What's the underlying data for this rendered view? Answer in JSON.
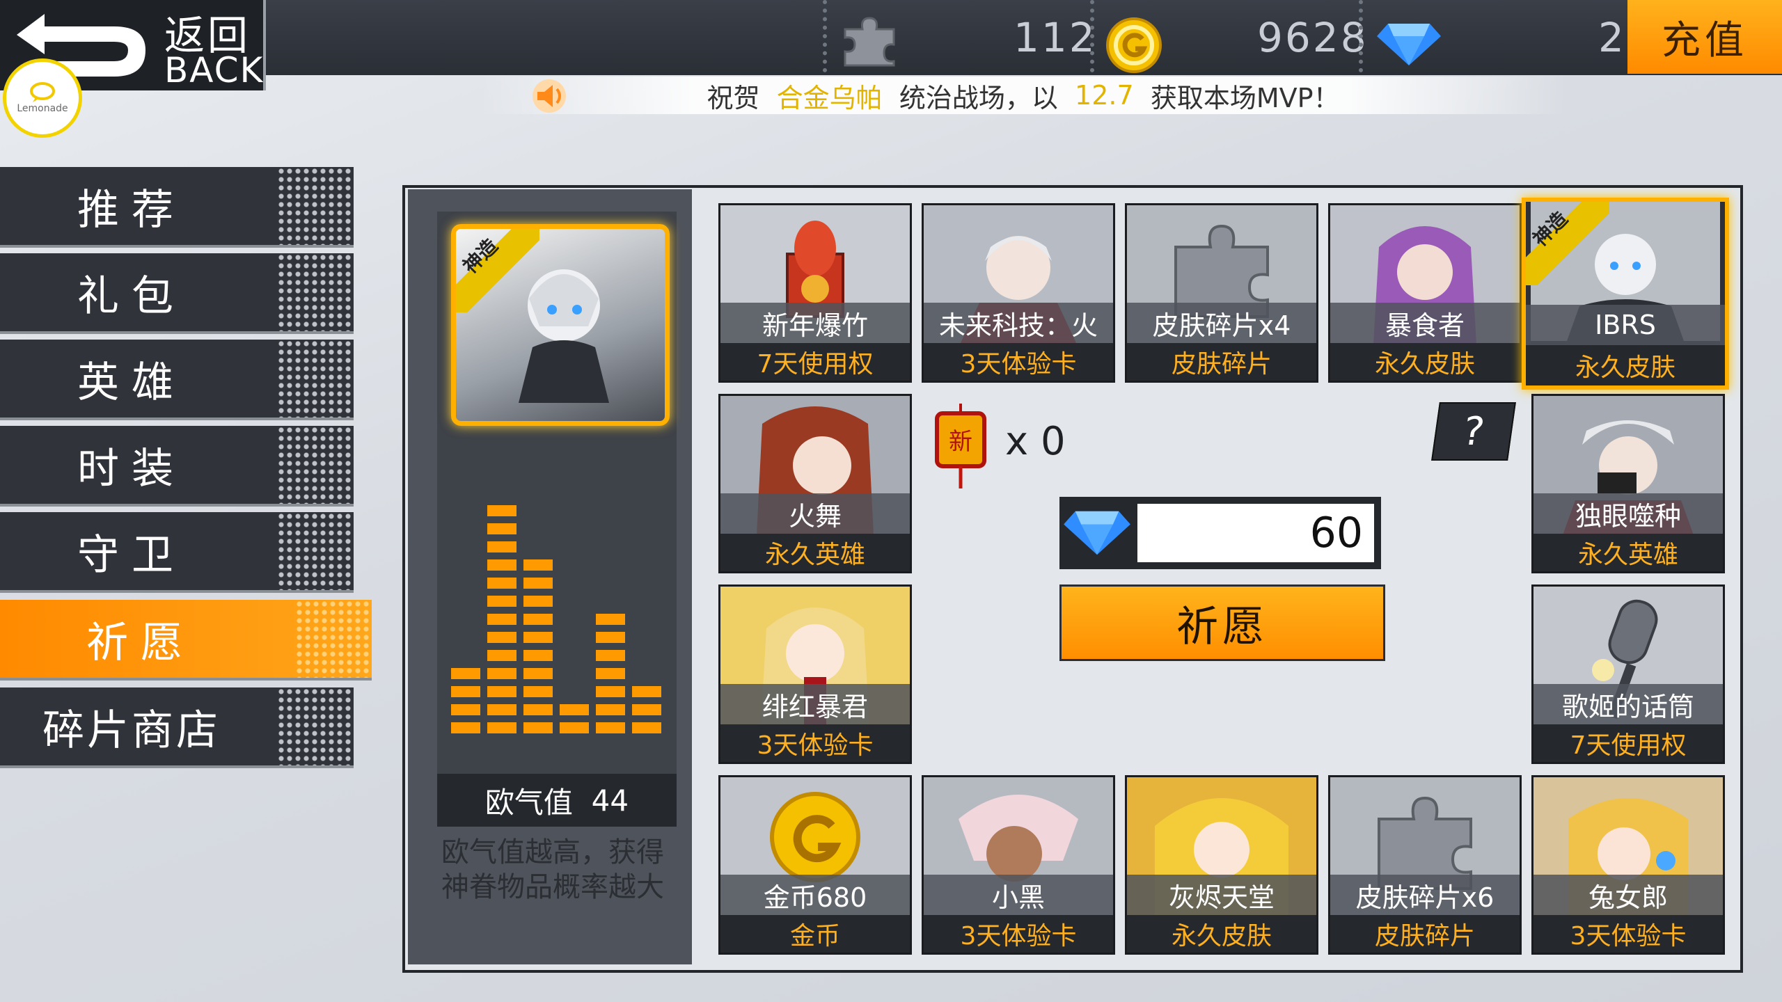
{
  "back": {
    "label_cn": "返回",
    "label_en": "BACK",
    "logo_text": "Lemonade"
  },
  "resources": {
    "fragments": "112",
    "gold": "9628",
    "diamonds": "2",
    "recharge_label": "充值"
  },
  "notice": {
    "prefix": "祝贺",
    "player": "合金乌帕",
    "middle": "统治战场，以",
    "score": "12.7",
    "suffix": "获取本场MVP！"
  },
  "sidebar": {
    "items": [
      {
        "label": "推荐",
        "active": false
      },
      {
        "label": "礼包",
        "active": false
      },
      {
        "label": "英雄",
        "active": false
      },
      {
        "label": "时装",
        "active": false
      },
      {
        "label": "守卫",
        "active": false
      },
      {
        "label": "祈愿",
        "active": true
      },
      {
        "label": "碎片商店",
        "active": false
      }
    ]
  },
  "featured": {
    "badge": "神造"
  },
  "luck": {
    "label": "欧气值",
    "value": "44",
    "description_line1": "欧气值越高，获得",
    "description_line2": "神眷物品概率越大"
  },
  "wish": {
    "ticket_count": "x 0",
    "cost": "60",
    "button_label": "祈愿",
    "help_label": "?"
  },
  "grid": {
    "items": [
      {
        "name": "新年爆竹",
        "type": "7天使用权"
      },
      {
        "name": "未来科技：火",
        "type": "3天体验卡"
      },
      {
        "name": "皮肤碎片x4",
        "type": "皮肤碎片"
      },
      {
        "name": "暴食者",
        "type": "永久皮肤"
      },
      {
        "name": "IBRS",
        "type": "永久皮肤",
        "badge": "神造"
      },
      {
        "name": "火舞",
        "type": "永久英雄"
      },
      {
        "name": "独眼噬种",
        "type": "永久英雄"
      },
      {
        "name": "绯红暴君",
        "type": "3天体验卡"
      },
      {
        "name": "歌姬的话筒",
        "type": "7天使用权"
      },
      {
        "name": "金币680",
        "type": "金币"
      },
      {
        "name": "小黑",
        "type": "3天体验卡"
      },
      {
        "name": "灰烬天堂",
        "type": "永久皮肤"
      },
      {
        "name": "皮肤碎片x6",
        "type": "皮肤碎片"
      },
      {
        "name": "兔女郎",
        "type": "3天体验卡"
      }
    ]
  },
  "colors": {
    "accent": "#ff9a00",
    "gold_text": "#ffb020",
    "highlight": "#e2b400",
    "dark": "#2d3036"
  }
}
